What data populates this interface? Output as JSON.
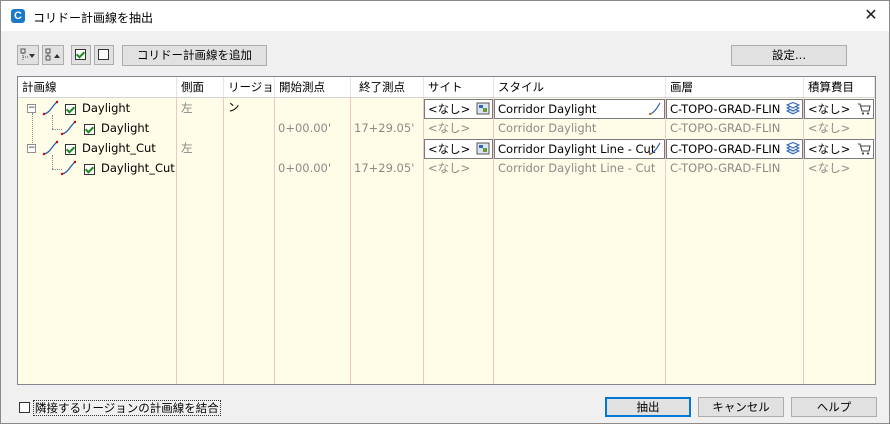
{
  "window": {
    "title": "コリドー計画線を抽出",
    "close_icon": "close-icon"
  },
  "toolbar": {
    "add_button": "コリドー計画線を追加",
    "settings_button": "設定..."
  },
  "columns": [
    "計画線",
    "側面",
    "リージョン",
    "開始測点",
    "終了測点",
    "サイト",
    "スタイル",
    "画層",
    "積算費目"
  ],
  "rows": [
    {
      "name": "Daylight",
      "side": "左",
      "region": "",
      "start": "",
      "end": "",
      "site": "<なし>",
      "style": "Corridor Daylight",
      "layer": "C-TOPO-GRAD-FLIN",
      "pay": "<なし>",
      "level": 0,
      "checked": true,
      "editable": true
    },
    {
      "name": "Daylight",
      "side": "",
      "region": "",
      "start": "0+00.00'",
      "end": "17+29.05'",
      "site": "<なし>",
      "style": "Corridor Daylight",
      "layer": "C-TOPO-GRAD-FLIN",
      "pay": "<なし>",
      "level": 1,
      "checked": true,
      "editable": false
    },
    {
      "name": "Daylight_Cut",
      "side": "左",
      "region": "",
      "start": "",
      "end": "",
      "site": "<なし>",
      "style": "Corridor Daylight Line - Cut",
      "layer": "C-TOPO-GRAD-FLIN",
      "pay": "<なし>",
      "level": 0,
      "checked": true,
      "editable": true
    },
    {
      "name": "Daylight_Cut",
      "side": "",
      "region": "",
      "start": "0+00.00'",
      "end": "17+29.05'",
      "site": "<なし>",
      "style": "Corridor Daylight Line - Cut",
      "layer": "C-TOPO-GRAD-FLIN",
      "pay": "<なし>",
      "level": 1,
      "checked": true,
      "editable": false
    }
  ],
  "footer": {
    "merge_label": "隣接するリージョンの計画線を結合",
    "merge_checked": false,
    "extract_button": "抽出",
    "cancel_button": "キャンセル",
    "help_button": "ヘルプ"
  },
  "colors": {
    "grid_bg": "#fffde7",
    "accent": "#0078d7",
    "column_line": "#efc6c6"
  }
}
